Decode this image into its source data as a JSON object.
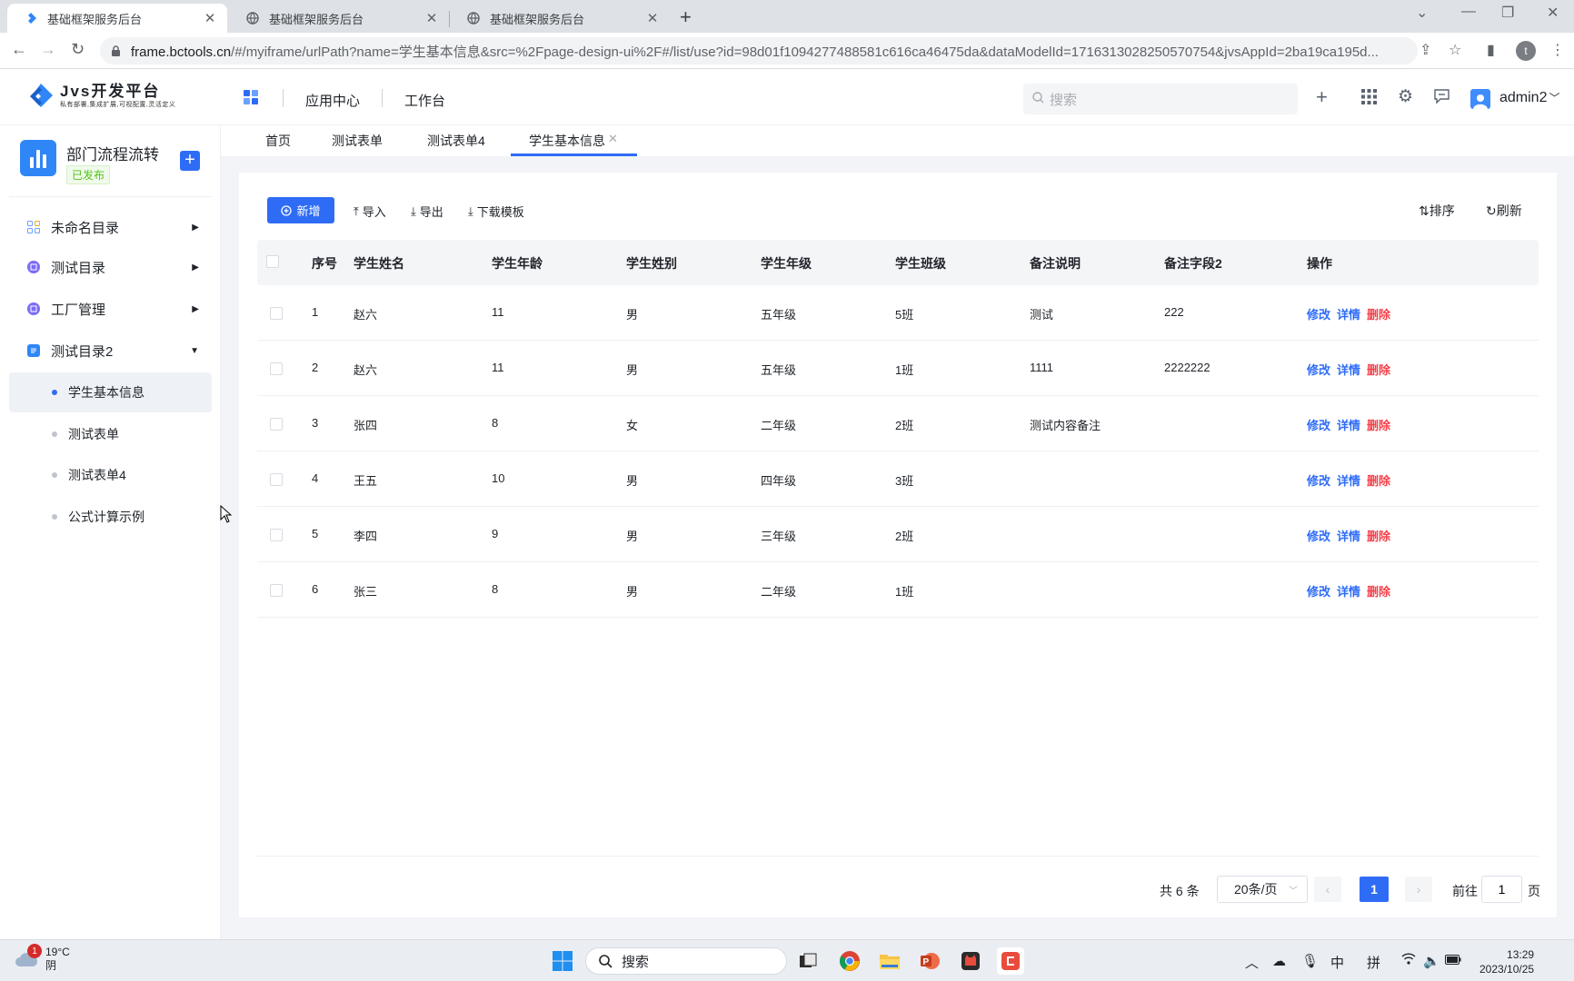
{
  "browser": {
    "tabs": [
      {
        "title": "基础框架服务后台",
        "active": true
      },
      {
        "title": "基础框架服务后台",
        "active": false
      },
      {
        "title": "基础框架服务后台",
        "active": false
      }
    ],
    "url_host": "frame.bctools.cn",
    "url_path": "/#/myiframe/urlPath?name=学生基本信息&src=%2Fpage-design-ui%2F#/list/use?id=98d01f1094277488581c616ca46475da&dataModelId=1716313028250570754&jvsAppId=2ba19ca195d...",
    "profile_initial": "t"
  },
  "header": {
    "logo_name": "Jvs开发平台",
    "logo_slogan": "私有部署,集成扩展,可视配置,灵活定义",
    "nav": [
      "应用中心",
      "工作台"
    ],
    "search_placeholder": "搜索",
    "username": "admin2"
  },
  "sidebar": {
    "app_name": "部门流程流转",
    "app_status": "已发布",
    "menus": [
      {
        "label": "未命名目录",
        "expanded": false
      },
      {
        "label": "测试目录",
        "expanded": false
      },
      {
        "label": "工厂管理",
        "expanded": false
      },
      {
        "label": "测试目录2",
        "expanded": true
      }
    ],
    "submenus": [
      {
        "label": "学生基本信息",
        "active": true
      },
      {
        "label": "测试表单",
        "active": false
      },
      {
        "label": "测试表单4",
        "active": false
      },
      {
        "label": "公式计算示例",
        "active": false
      }
    ]
  },
  "content_tabs": [
    "首页",
    "测试表单",
    "测试表单4",
    "学生基本信息"
  ],
  "toolbar": {
    "add": "新增",
    "import": "导入",
    "export": "导出",
    "download_template": "下载模板",
    "sort": "排序",
    "refresh": "刷新"
  },
  "table": {
    "headers": [
      "序号",
      "学生姓名",
      "学生年龄",
      "学生姓别",
      "学生年级",
      "学生班级",
      "备注说明",
      "备注字段2",
      "操作"
    ],
    "rows": [
      {
        "no": "1",
        "name": "赵六",
        "age": "11",
        "gender": "男",
        "grade": "五年级",
        "class": "5班",
        "remark": "测试",
        "remark2": "222"
      },
      {
        "no": "2",
        "name": "赵六",
        "age": "11",
        "gender": "男",
        "grade": "五年级",
        "class": "1班",
        "remark": "1111",
        "remark2": "2222222"
      },
      {
        "no": "3",
        "name": "张四",
        "age": "8",
        "gender": "女",
        "grade": "二年级",
        "class": "2班",
        "remark": "测试内容备注",
        "remark2": ""
      },
      {
        "no": "4",
        "name": "王五",
        "age": "10",
        "gender": "男",
        "grade": "四年级",
        "class": "3班",
        "remark": "",
        "remark2": ""
      },
      {
        "no": "5",
        "name": "李四",
        "age": "9",
        "gender": "男",
        "grade": "三年级",
        "class": "2班",
        "remark": "",
        "remark2": ""
      },
      {
        "no": "6",
        "name": "张三",
        "age": "8",
        "gender": "男",
        "grade": "二年级",
        "class": "1班",
        "remark": "",
        "remark2": ""
      }
    ],
    "actions": {
      "edit": "修改",
      "detail": "详情",
      "delete": "删除"
    }
  },
  "pagination": {
    "total": "共 6 条",
    "page_size": "20条/页",
    "current_page": "1",
    "goto_label": "前往",
    "goto_value": "1",
    "unit": "页"
  },
  "taskbar": {
    "weather_temp": "19°C",
    "weather_desc": "阴",
    "weather_badge": "1",
    "search": "搜索",
    "ime_lang": "中",
    "ime_mode": "拼",
    "time": "13:29",
    "date": "2023/10/25"
  },
  "colors": {
    "primary": "#2f6cf6",
    "danger": "#f5414b",
    "success": "#52c41a"
  }
}
